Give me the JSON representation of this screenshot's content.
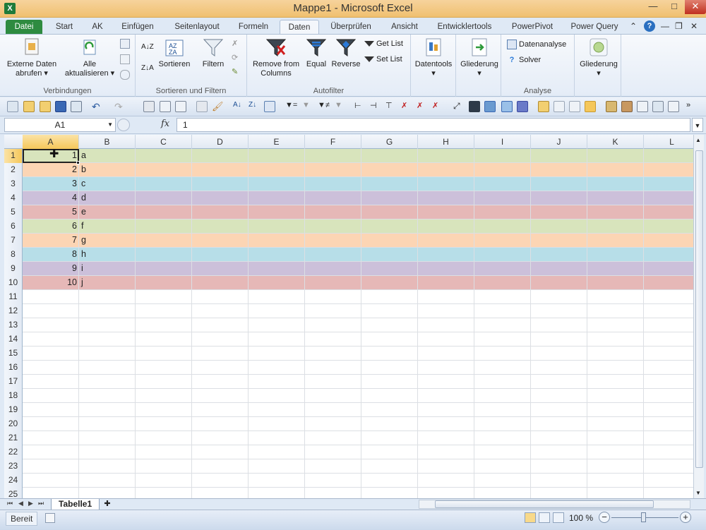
{
  "window": {
    "title": "Mappe1  -  Microsoft Excel",
    "app_icon": "X"
  },
  "ribbon_tabs": [
    "Datei",
    "Start",
    "AK",
    "Einfügen",
    "Seitenlayout",
    "Formeln",
    "Daten",
    "Überprüfen",
    "Ansicht",
    "Entwicklertools",
    "PowerPivot",
    "Power Query"
  ],
  "active_tab": "Daten",
  "ribbon": {
    "verbindungen": {
      "label": "Verbindungen",
      "externe_daten": "Externe Daten abrufen",
      "alle_aktualisieren": "Alle aktualisieren"
    },
    "sortieren": {
      "label": "Sortieren und Filtern",
      "sortieren": "Sortieren",
      "filtern": "Filtern"
    },
    "autofilter": {
      "label": "Autofilter",
      "remove_from_columns": "Remove from Columns",
      "equal": "Equal",
      "reverse": "Reverse",
      "get_list": "Get List",
      "set_list": "Set List"
    },
    "datentools": {
      "label": "Datentools"
    },
    "gliederung1": {
      "label": "Gliederung"
    },
    "analyse": {
      "label": "Analyse",
      "datenanalyse": "Datenanalyse",
      "solver": "Solver"
    },
    "gliederung2": {
      "label": "Gliederung"
    }
  },
  "formula_bar": {
    "name_box": "A1",
    "fx": "fx",
    "value": "1"
  },
  "grid": {
    "columns": [
      "A",
      "B",
      "C",
      "D",
      "E",
      "F",
      "G",
      "H",
      "I",
      "J",
      "K",
      "L"
    ],
    "row_numbers": [
      "1",
      "2",
      "3",
      "4",
      "5",
      "6",
      "7",
      "8",
      "9",
      "10",
      "11",
      "12",
      "13",
      "14",
      "15",
      "16",
      "17",
      "18",
      "19",
      "20",
      "21",
      "22",
      "23",
      "24",
      "25"
    ],
    "data": [
      {
        "a": "1",
        "b": "a",
        "color": "#d8e4bc"
      },
      {
        "a": "2",
        "b": "b",
        "color": "#fcd5b4"
      },
      {
        "a": "3",
        "b": "c",
        "color": "#b7dee8"
      },
      {
        "a": "4",
        "b": "d",
        "color": "#ccc0da"
      },
      {
        "a": "5",
        "b": "e",
        "color": "#e6b8b7"
      },
      {
        "a": "6",
        "b": "f",
        "color": "#d8e4bc"
      },
      {
        "a": "7",
        "b": "g",
        "color": "#fcd5b4"
      },
      {
        "a": "8",
        "b": "h",
        "color": "#b7dee8"
      },
      {
        "a": "9",
        "b": "i",
        "color": "#ccc0da"
      },
      {
        "a": "10",
        "b": "j",
        "color": "#e6b8b7"
      }
    ]
  },
  "sheet_tabs": {
    "active": "Tabelle1"
  },
  "status_bar": {
    "status": "Bereit",
    "zoom": "100 %"
  },
  "colors": {
    "file_tab": "#2e8b40",
    "selection": "#f5c75a"
  }
}
